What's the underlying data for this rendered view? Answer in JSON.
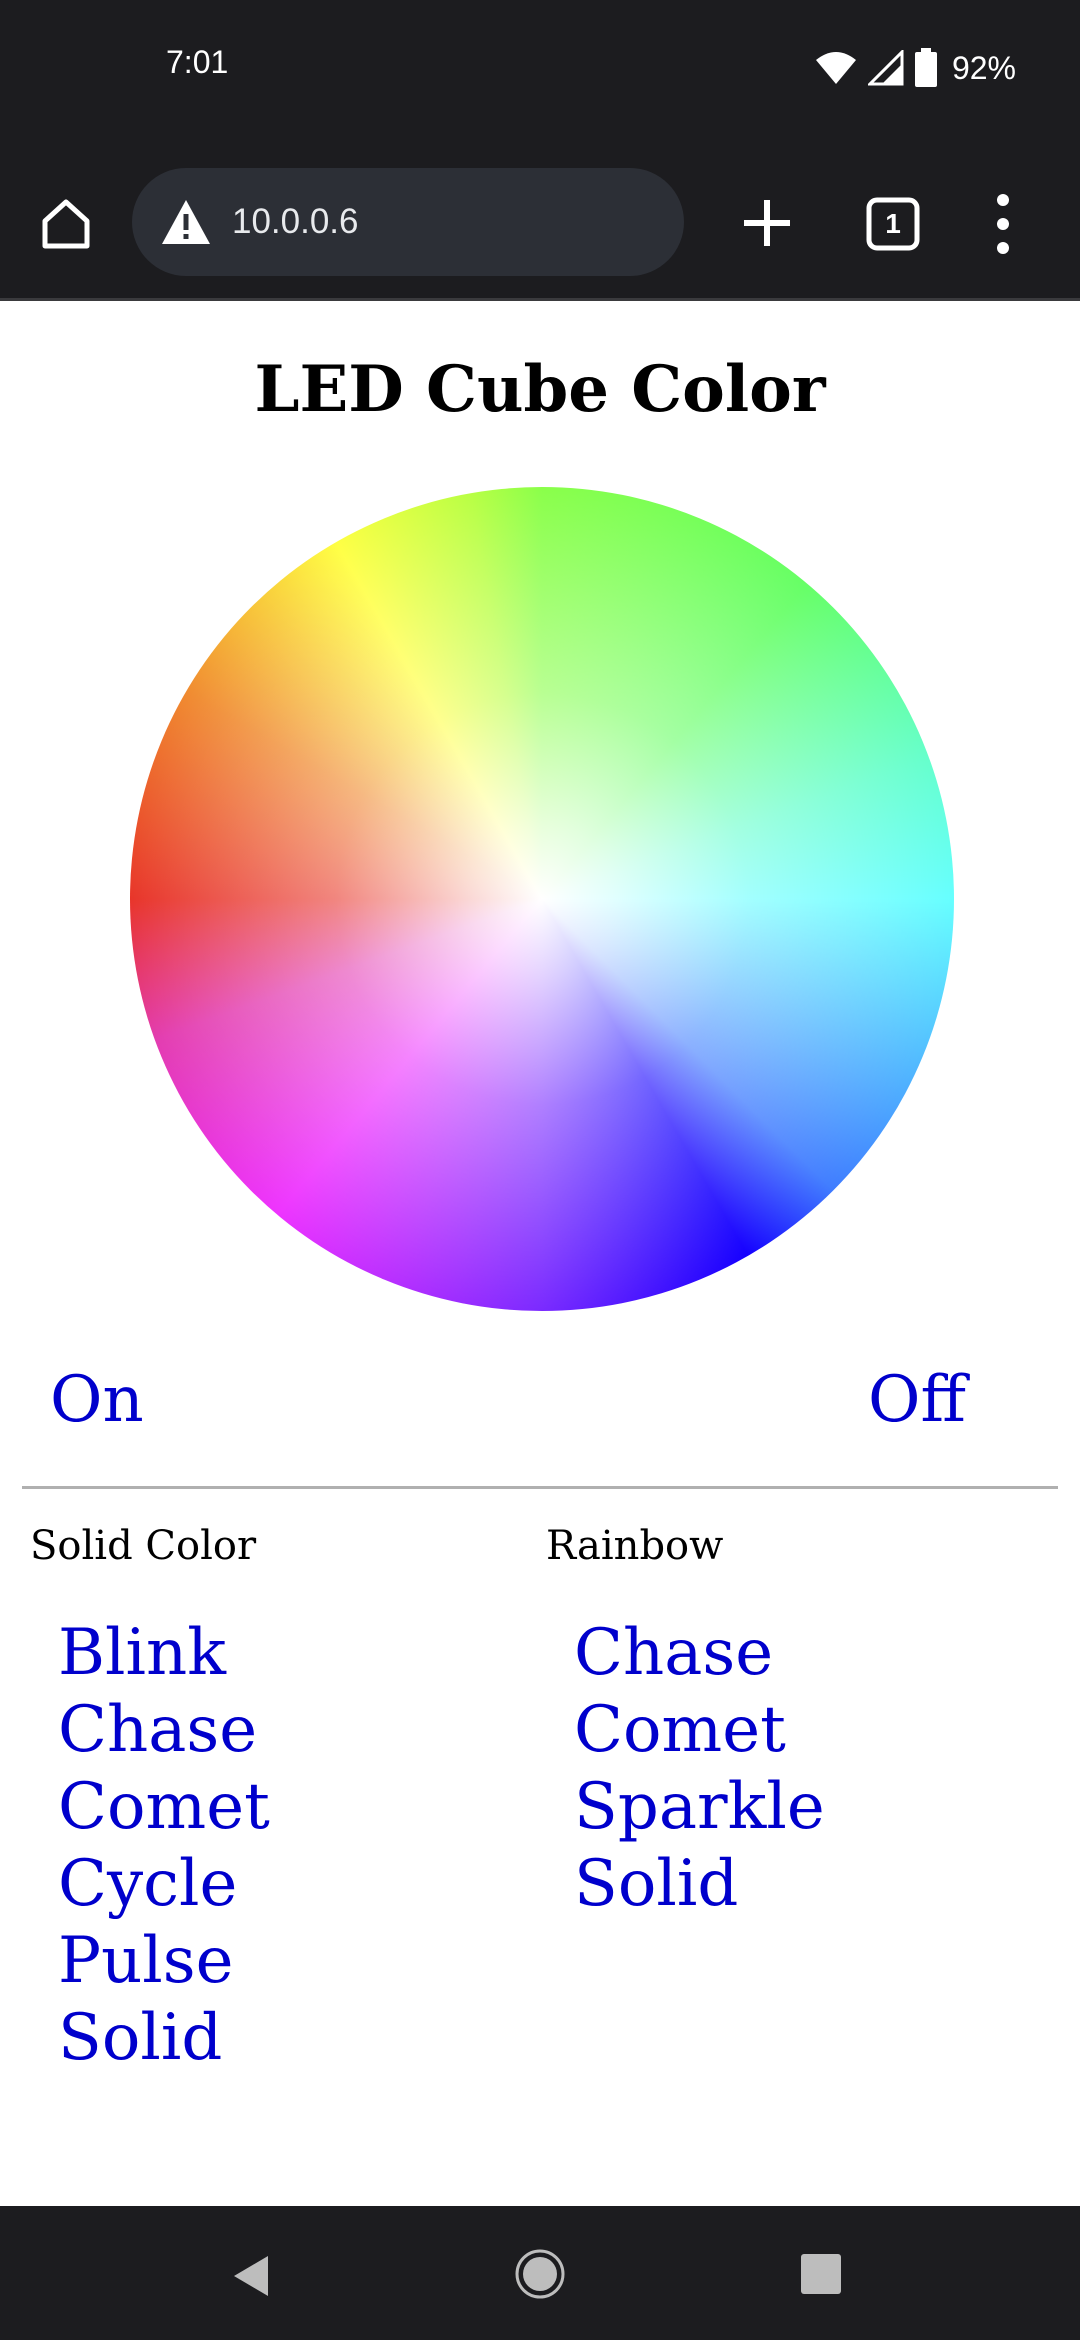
{
  "status_bar": {
    "time": "7:01",
    "battery_percent": "92%",
    "icons": [
      "wifi-icon",
      "cell-signal-icon",
      "battery-icon"
    ]
  },
  "browser": {
    "url": "10.0.0.6",
    "tab_count": "1",
    "icons": [
      "home-icon",
      "warning-icon",
      "new-tab-icon",
      "tab-switcher-icon",
      "overflow-menu-icon"
    ]
  },
  "page": {
    "title": "LED Cube Color",
    "power": {
      "on_label": "On",
      "off_label": "Off"
    },
    "solid_color": {
      "heading": "Solid Color",
      "effects": [
        "Blink",
        "Chase",
        "Comet",
        "Cycle",
        "Pulse",
        "Solid"
      ]
    },
    "rainbow": {
      "heading": "Rainbow",
      "effects": [
        "Chase",
        "Comet",
        "Sparkle",
        "Solid"
      ]
    }
  },
  "nav_bar": {
    "icons": [
      "back-icon",
      "home-circle-icon",
      "recents-icon"
    ]
  },
  "colors": {
    "link": "#0000cc",
    "bar_background": "#1c1c1f",
    "omnibox_background": "#2c2f36"
  }
}
